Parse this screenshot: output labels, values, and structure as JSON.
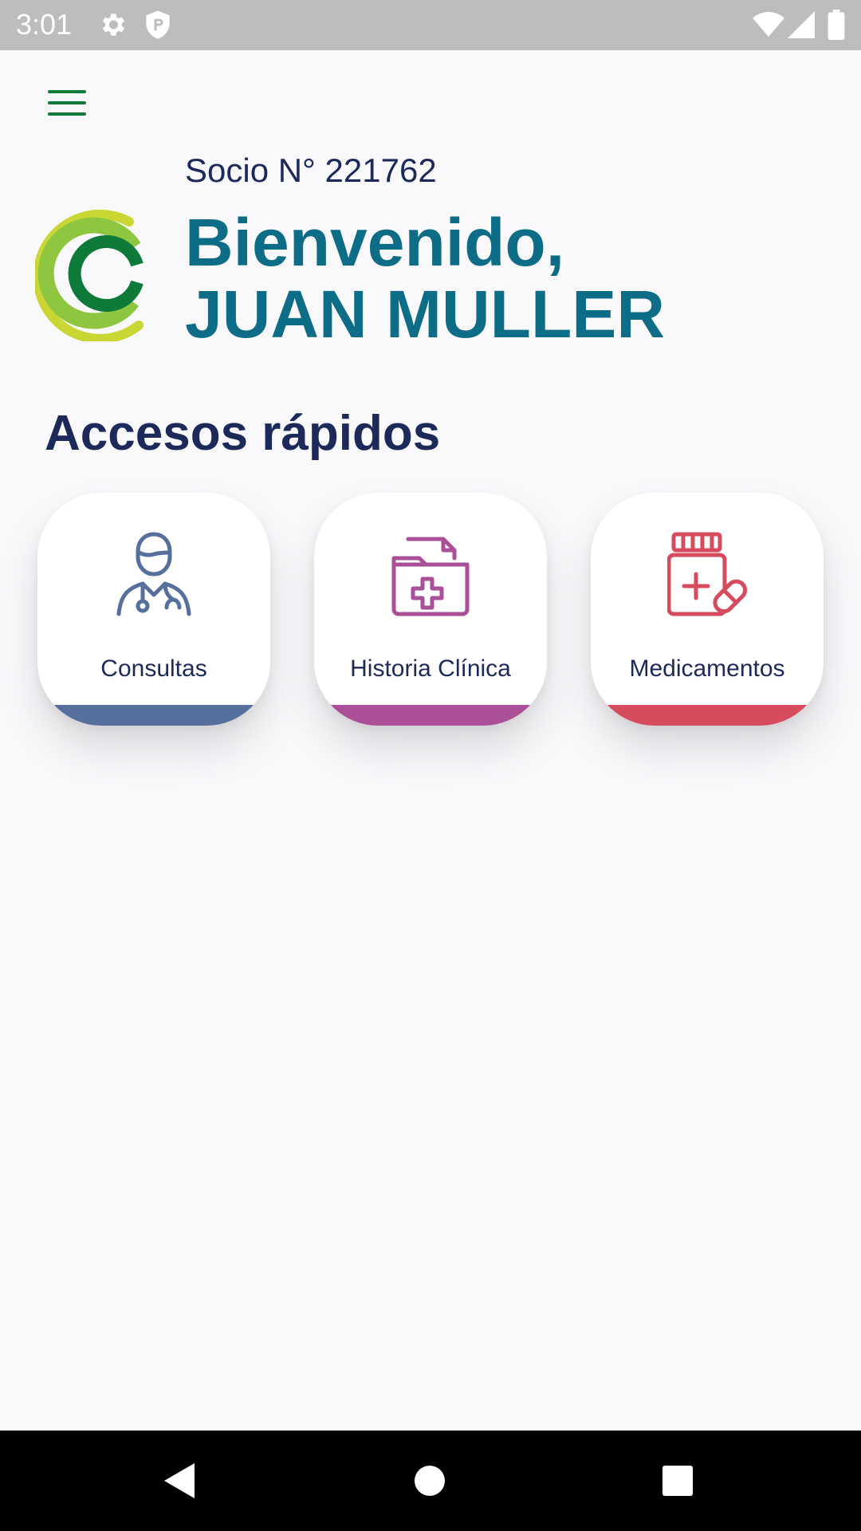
{
  "status_bar": {
    "time": "3:01",
    "icons": [
      "settings-icon",
      "shield-icon",
      "wifi-icon",
      "signal-icon",
      "battery-icon"
    ]
  },
  "header": {
    "menu_icon": "hamburger-menu-icon"
  },
  "greeting": {
    "member_label": "Socio N° 221762",
    "welcome": "Bienvenido,",
    "name": "JUAN MULLER"
  },
  "quick_access": {
    "title": "Accesos rápidos",
    "items": [
      {
        "label": "Consultas",
        "icon": "doctor-icon",
        "color": "#566f9c"
      },
      {
        "label": "Historia Clínica",
        "icon": "medical-folder-icon",
        "color": "#aa4f98"
      },
      {
        "label": "Medicamentos",
        "icon": "medicine-bottle-icon",
        "color": "#d64b5d"
      }
    ]
  },
  "colors": {
    "brand_green": "#0d7a3a",
    "title_teal": "#0d6c86",
    "text_navy": "#1c2959",
    "background": "#f9f8fb"
  },
  "nav_bar": {
    "icons": [
      "back-icon",
      "home-icon",
      "recents-icon"
    ]
  }
}
